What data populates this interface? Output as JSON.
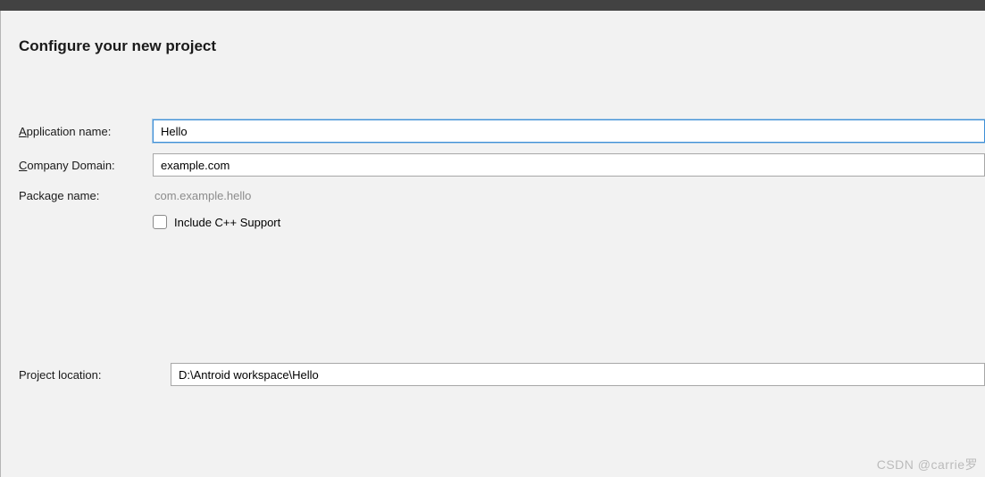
{
  "header": {
    "title": "Configure your new project"
  },
  "fields": {
    "application_name": {
      "label_pre": "A",
      "label_rest": "pplication name:",
      "value": "Hello"
    },
    "company_domain": {
      "label_pre": "C",
      "label_rest": "ompany Domain:",
      "value": "example.com"
    },
    "package_name": {
      "label": "Package name:",
      "value": "com.example.hello"
    },
    "include_cpp": {
      "label": "Include C++ Support",
      "checked": false
    },
    "project_location": {
      "label": "Project location:",
      "value": "D:\\Antroid workspace\\Hello"
    }
  },
  "watermark": "CSDN @carrie罗"
}
